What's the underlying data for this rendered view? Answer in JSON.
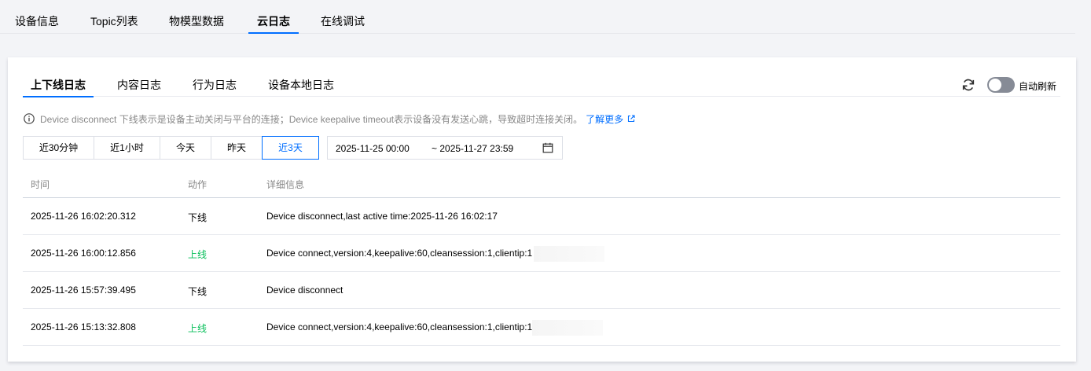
{
  "top_tabs": [
    "设备信息",
    "Topic列表",
    "物模型数据",
    "云日志",
    "在线调试"
  ],
  "sub_tabs": [
    "上下线日志",
    "内容日志",
    "行为日志",
    "设备本地日志"
  ],
  "auto_refresh_label": "自动刷新",
  "auto_refresh_on": false,
  "notice": {
    "text": "Device disconnect 下线表示是设备主动关闭与平台的连接；Device keepalive timeout表示设备没有发送心跳，导致超时连接关闭。",
    "link": "了解更多"
  },
  "time_ranges": [
    "近30分钟",
    "近1小时",
    "今天",
    "昨天",
    "近3天"
  ],
  "active_time_range": "近3天",
  "date_range": {
    "start": "2025-11-25 00:00",
    "end": "~ 2025-11-27 23:59"
  },
  "table": {
    "headers": [
      "时间",
      "动作",
      "详细信息"
    ],
    "rows": [
      {
        "time": "2025-11-26 16:02:20.312",
        "action": "下线",
        "detail": "Device disconnect,last active time:2025-11-26 16:02:17"
      },
      {
        "time": "2025-11-26 16:00:12.856",
        "action": "上线",
        "detail": "Device connect,version:4,keepalive:60,cleansession:1,clientip:1"
      },
      {
        "time": "2025-11-26 15:57:39.495",
        "action": "下线",
        "detail": "Device disconnect"
      },
      {
        "time": "2025-11-26 15:13:32.808",
        "action": "上线",
        "detail": "Device connect,version:4,keepalive:60,cleansession:1,clientip:1"
      }
    ]
  },
  "colors": {
    "accent": "#006eff",
    "online": "#0abf5b",
    "muted": "#888888"
  }
}
